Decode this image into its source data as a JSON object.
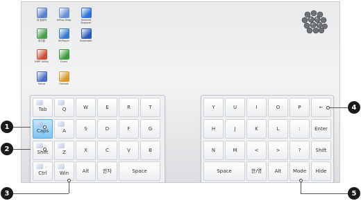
{
  "desktop_icons": [
    {
      "label": "내 컴퓨터",
      "icon": "computer-icon",
      "color": "#5b7fc4"
    },
    {
      "label": "InPlug Drop",
      "icon": "document-icon",
      "color": "#6b8fd0"
    },
    {
      "label": "Internet Explorer",
      "icon": "internet-explorer-icon",
      "color": "#2f6fd6"
    },
    {
      "label": "휴지통",
      "icon": "recycle-bin-icon",
      "color": "#4e9a4e"
    },
    {
      "label": "KitPlayer",
      "icon": "player-icon",
      "color": "#3a7acb"
    },
    {
      "label": "Bluetooth",
      "icon": "bluetooth-icon",
      "color": "#2b56b8"
    },
    {
      "label": "HWP Utility",
      "icon": "network-icon",
      "color": "#c84f3a"
    },
    {
      "label": "Excel",
      "icon": "excel-icon",
      "color": "#3f9a3f"
    },
    {
      "label": "Setup",
      "icon": "setup-icon",
      "color": "#4a6bbf"
    },
    {
      "label": "Outlook",
      "icon": "outlook-icon",
      "color": "#d79a2c"
    }
  ],
  "left_keys": [
    {
      "label": "Tab",
      "icon": "tab-icon"
    },
    {
      "label": "Q",
      "icon": "q-icon"
    },
    {
      "label": "W"
    },
    {
      "label": "E"
    },
    {
      "label": "R"
    },
    {
      "label": "T"
    },
    {
      "label": "Caps",
      "icon": "caps-icon",
      "highlight": true
    },
    {
      "label": "A",
      "icon": "a-icon"
    },
    {
      "label": "S"
    },
    {
      "label": "D"
    },
    {
      "label": "F"
    },
    {
      "label": "G"
    },
    {
      "label": "Shift",
      "icon": "shift-icon"
    },
    {
      "label": "Z",
      "icon": "z-icon"
    },
    {
      "label": "X"
    },
    {
      "label": "C"
    },
    {
      "label": "V"
    },
    {
      "label": "B"
    },
    {
      "label": "Ctrl",
      "icon": "ctrl-icon"
    },
    {
      "label": "Win",
      "icon": "win-icon"
    },
    {
      "label": "Alt"
    },
    {
      "label": "한자"
    },
    {
      "label": "Space"
    }
  ],
  "right_keys": [
    {
      "label": "Y"
    },
    {
      "label": "U"
    },
    {
      "label": "I"
    },
    {
      "label": "O"
    },
    {
      "label": "P"
    },
    {
      "label": "←"
    },
    {
      "label": "H"
    },
    {
      "label": "J"
    },
    {
      "label": "K"
    },
    {
      "label": "L"
    },
    {
      "label": ":"
    },
    {
      "label": "Enter"
    },
    {
      "label": "N"
    },
    {
      "label": "M"
    },
    {
      "label": "<"
    },
    {
      "label": ">"
    },
    {
      "label": "?"
    },
    {
      "label": "Shift"
    },
    {
      "label": "Space"
    },
    {
      "label": "한/영"
    },
    {
      "label": "Alt"
    },
    {
      "label": "Mode"
    },
    {
      "label": "Hide"
    }
  ],
  "callouts": [
    {
      "number": "1",
      "target": "Caps"
    },
    {
      "number": "2",
      "target": "Shift"
    },
    {
      "number": "3",
      "target": "Win"
    },
    {
      "number": "4",
      "target": "←"
    },
    {
      "number": "5",
      "target": "Mode"
    }
  ],
  "colors": {
    "highlight": "#7fc4f1",
    "callout": "#1a1a1a"
  }
}
